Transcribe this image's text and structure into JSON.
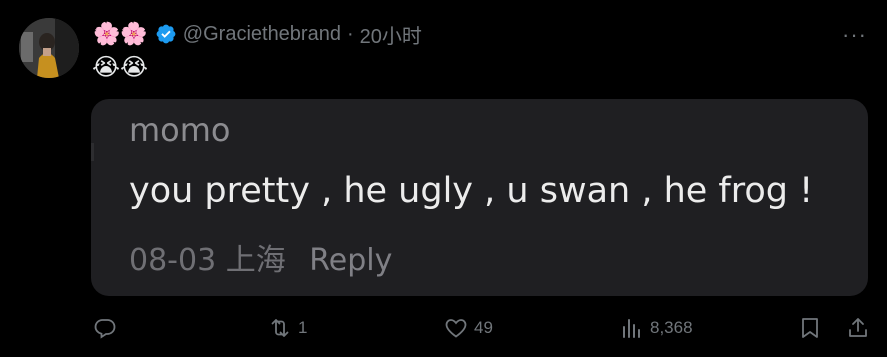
{
  "tweet": {
    "flowers": "🌸🌸",
    "handle": "@Graciethebrand",
    "separator": "·",
    "time": "20小时",
    "body_emoji": "😭😭",
    "more_label": "···"
  },
  "embedded": {
    "name": "momo",
    "text": "you pretty , he ugly , u swan , he frog !",
    "date": "08-03",
    "location": "上海",
    "reply": "Reply"
  },
  "actions": {
    "reply_count": "",
    "retweet_count": "1",
    "like_count": "49",
    "view_count": "8,368"
  },
  "colors": {
    "background": "#000000",
    "muted": "#71767b",
    "verified": "#1d9bf0",
    "card": "#1f1f22"
  }
}
